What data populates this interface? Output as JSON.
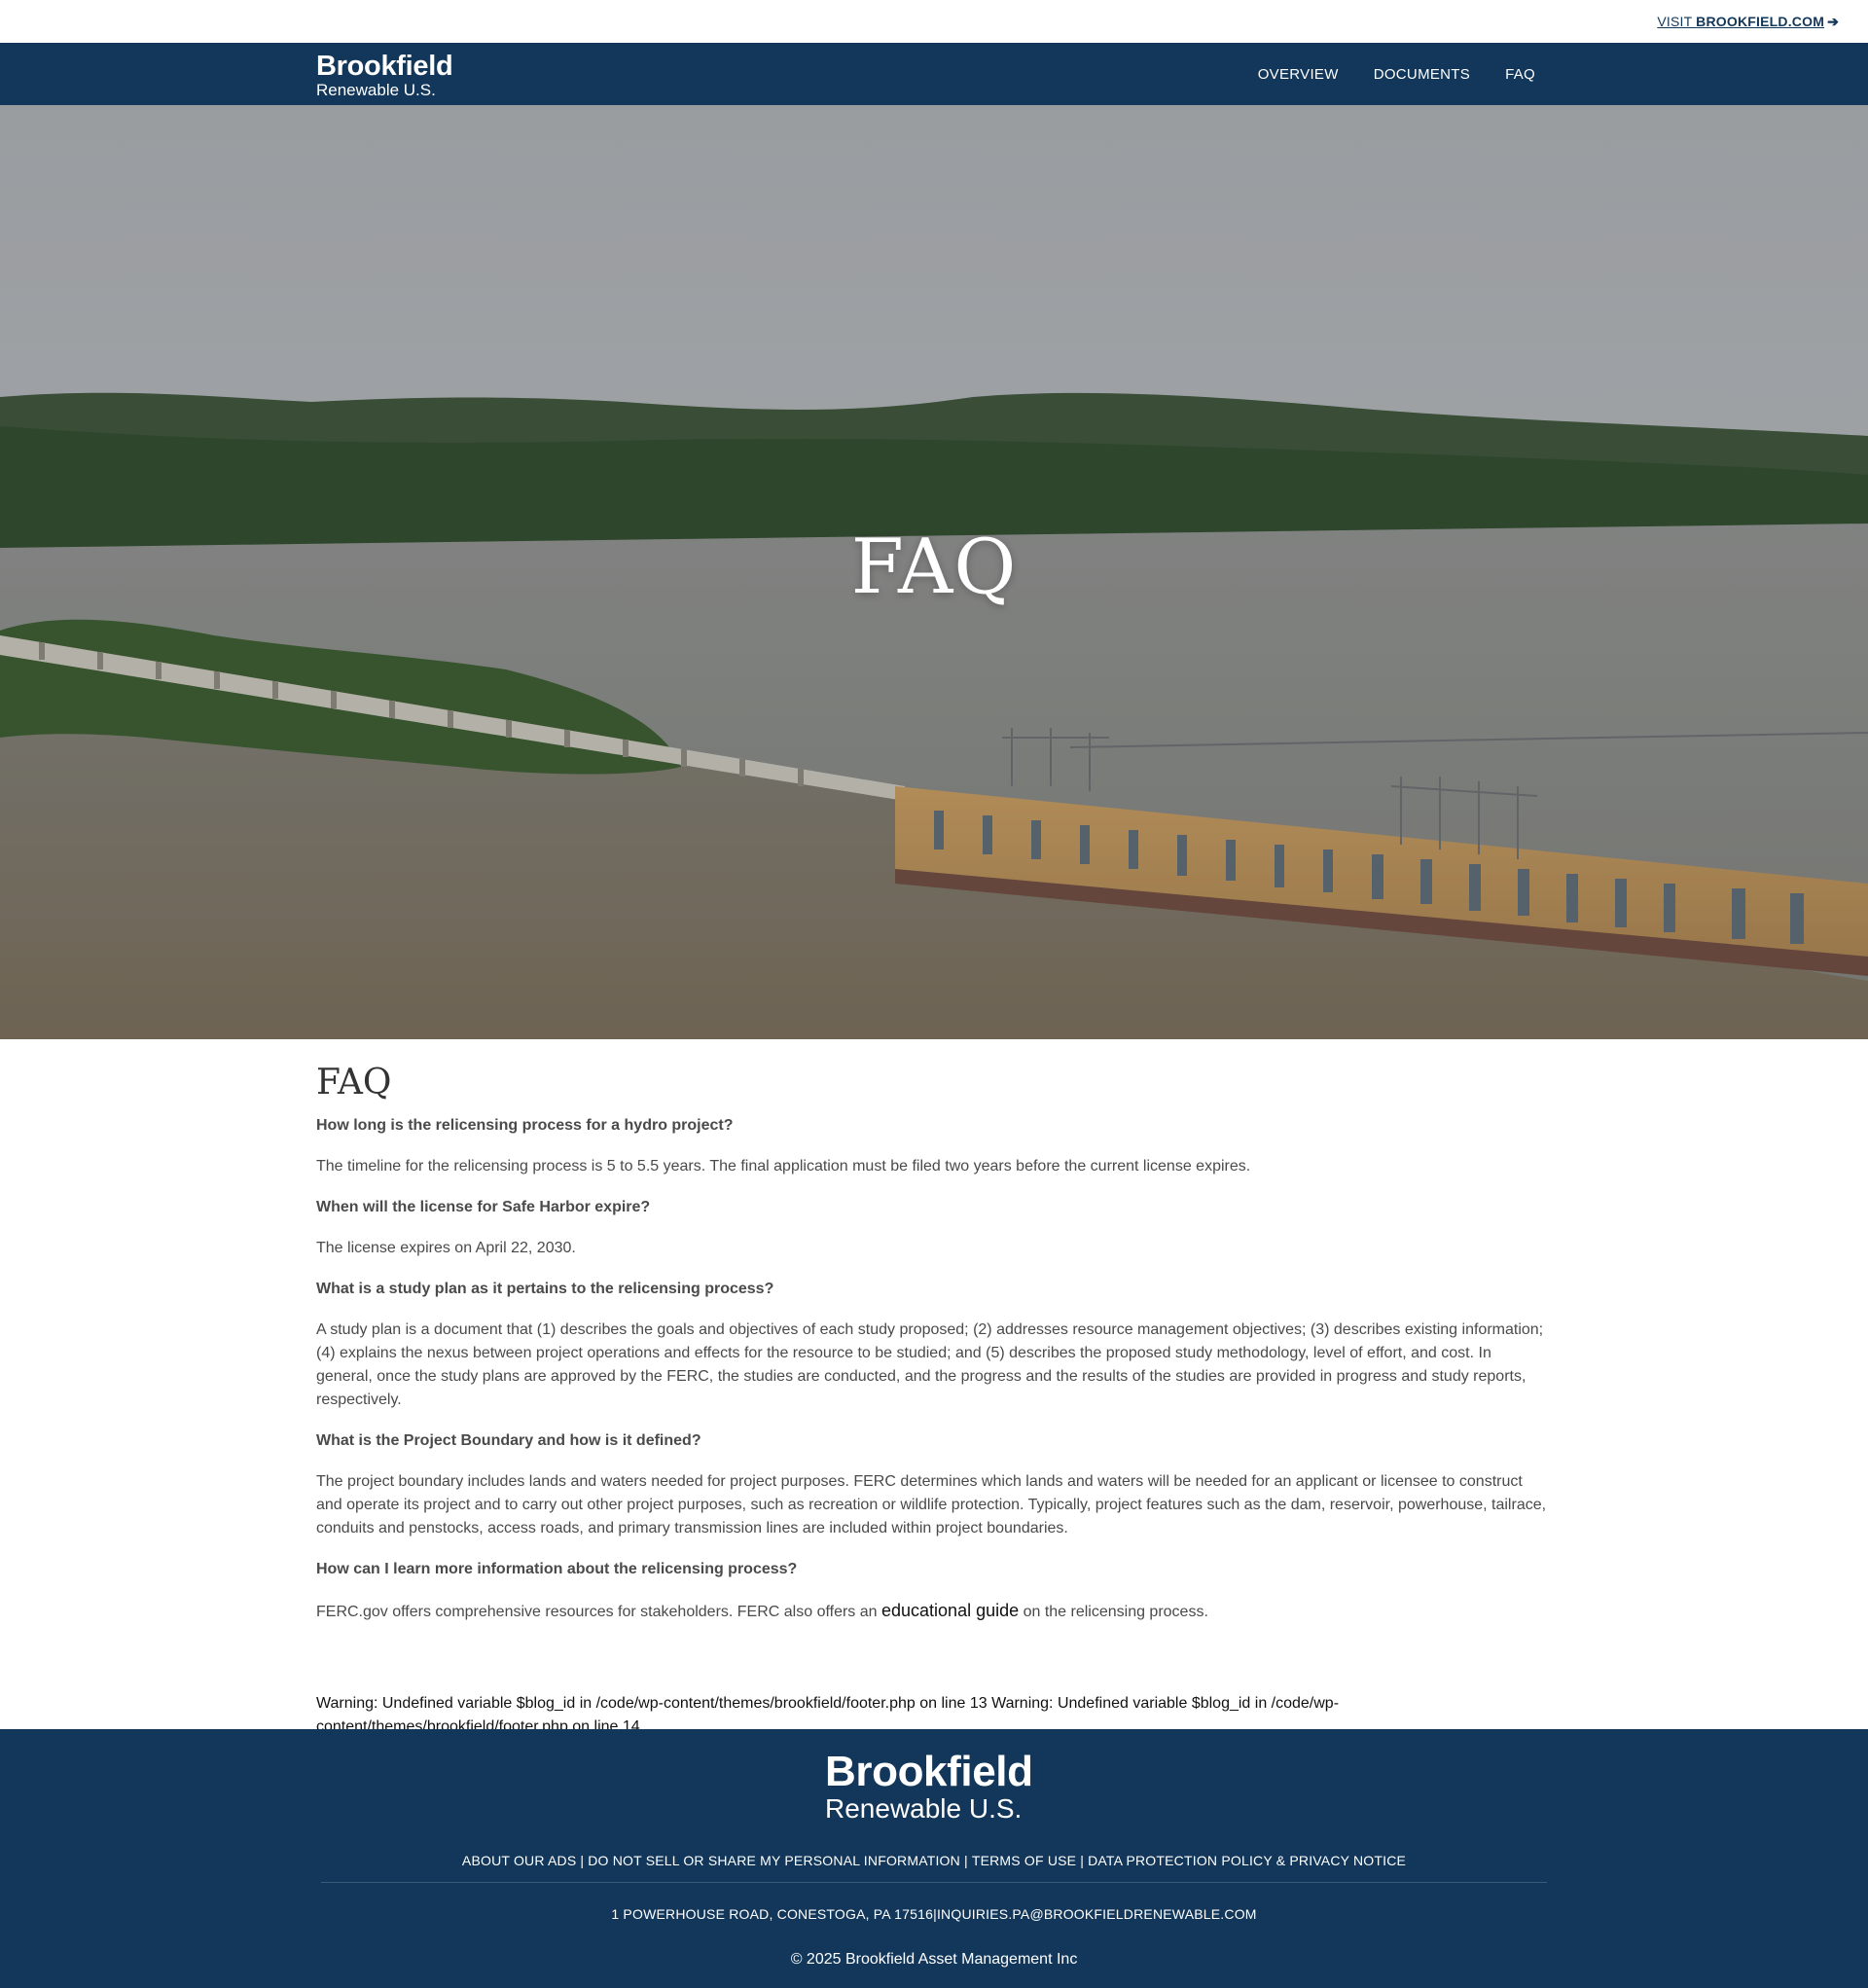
{
  "utility": {
    "visit_prefix": "VISIT ",
    "visit_site": "BROOKFIELD.COM",
    "visit_arrow_icon": "arrow-right-icon"
  },
  "header": {
    "logo_main": "Brookfield",
    "logo_sub": "Renewable U.S.",
    "nav": [
      {
        "label": "OVERVIEW"
      },
      {
        "label": "DOCUMENTS"
      },
      {
        "label": "FAQ"
      }
    ]
  },
  "hero": {
    "title": "FAQ"
  },
  "main": {
    "heading": "FAQ",
    "faqs": [
      {
        "question": "How long is the relicensing process for a hydro project?",
        "answer": "The timeline for the relicensing process is 5 to 5.5 years. The final application must be filed two years before the current license expires."
      },
      {
        "question": "When will the license for Safe Harbor expire?",
        "answer": "The license expires on April 22, 2030."
      },
      {
        "question": "What is a study plan as it pertains to the relicensing process?",
        "answer": "A study plan is a document that (1) describes the goals and objectives of each study proposed; (2) addresses resource management objectives; (3) describes existing information; (4) explains the nexus between project operations and effects for the resource to be studied; and (5) describes the proposed study methodology, level of effort, and cost. In general, once the study plans are approved by the FERC, the studies are conducted, and the progress and the results of the studies are provided in progress and study reports, respectively."
      },
      {
        "question": "What is the Project Boundary and how is it defined?",
        "answer": "The project boundary includes lands and waters needed for project purposes. FERC determines which lands and waters will be needed for an applicant or licensee to construct and operate its project and to carry out other project purposes, such as recreation or wildlife protection. Typically, project features such as the dam, reservoir, powerhouse, tailrace, conduits and penstocks, access roads, and primary transmission lines are included within project boundaries."
      },
      {
        "question": "How can I learn more information about the relicensing process?",
        "answer_before_link": "FERC.gov offers comprehensive resources for stakeholders. FERC also offers an ",
        "link_text": "educational guide",
        "answer_after_link": " on the relicensing process."
      }
    ]
  },
  "warning": "Warning: Undefined variable $blog_id in /code/wp-content/themes/brookfield/footer.php on line 13 Warning: Undefined variable $blog_id in /code/wp-content/themes/brookfield/footer.php on line 14",
  "footer": {
    "logo_main": "Brookfield",
    "logo_sub": "Renewable U.S.",
    "links": [
      {
        "label": "ABOUT OUR ADS"
      },
      {
        "label": "DO NOT SELL OR SHARE MY PERSONAL INFORMATION"
      },
      {
        "label": "TERMS OF USE"
      },
      {
        "label": "DATA PROTECTION POLICY & PRIVACY NOTICE"
      }
    ],
    "separator": "|",
    "address": "1 POWERHOUSE ROAD, CONESTOGA, PA 17516",
    "email": "INQUIRIES.PA@BROOKFIELDRENEWABLE.COM",
    "copyright": "© 2025 Brookfield Asset Management Inc"
  },
  "colors": {
    "brand_navy": "#12375a",
    "text_gray": "#4a4a4a"
  }
}
